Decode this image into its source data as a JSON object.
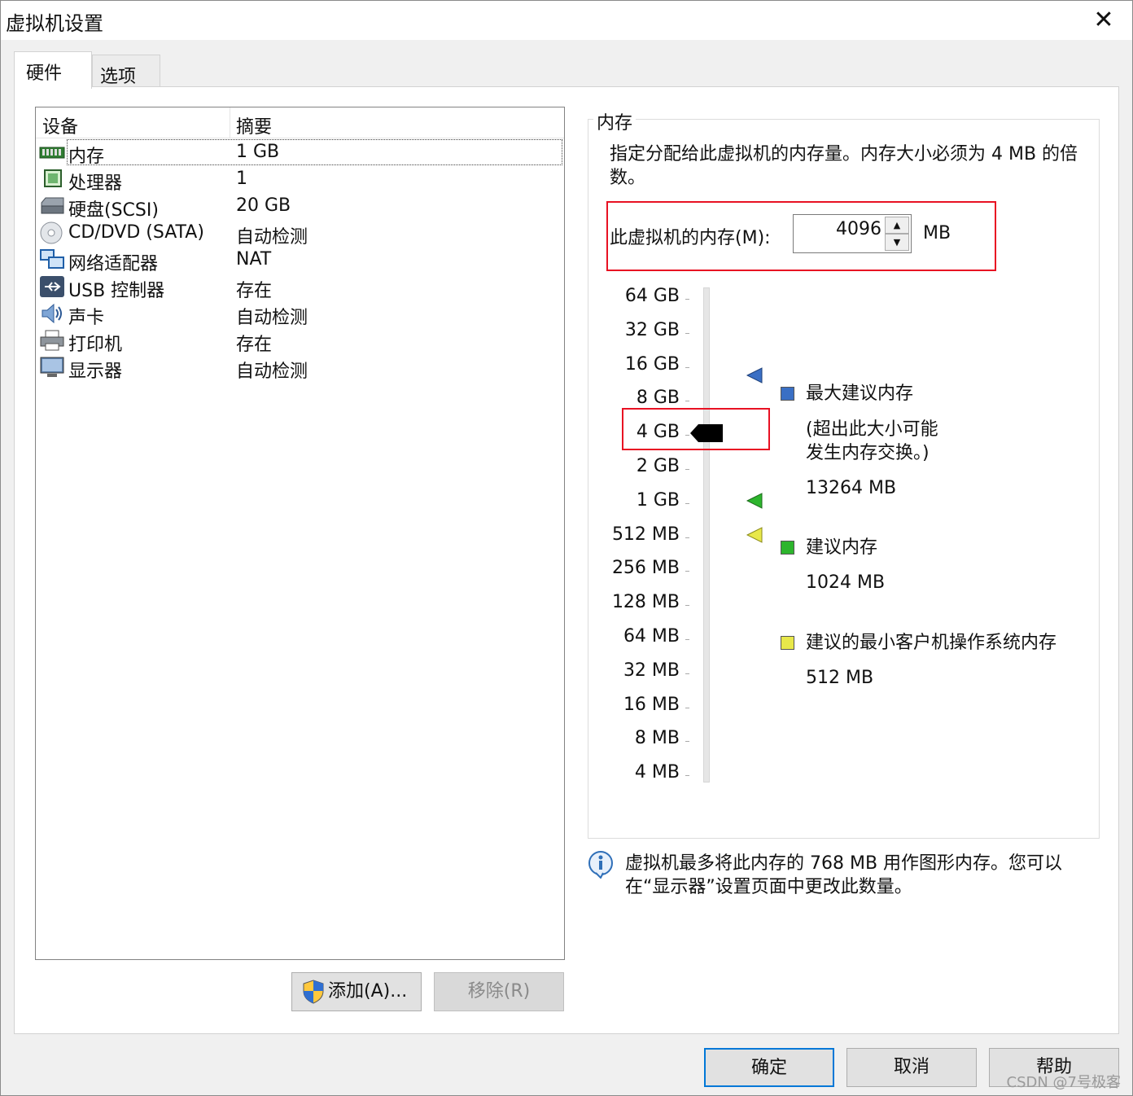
{
  "window": {
    "title": "虚拟机设置",
    "close": "✕"
  },
  "tabs": [
    {
      "label": "硬件"
    },
    {
      "label": "选项"
    }
  ],
  "device_list": {
    "col_device": "设备",
    "col_summary": "摘要",
    "rows": [
      {
        "name": "内存",
        "summary": "1 GB",
        "icon": "memory-icon"
      },
      {
        "name": "处理器",
        "summary": "1",
        "icon": "processor-icon"
      },
      {
        "name": "硬盘(SCSI)",
        "summary": "20 GB",
        "icon": "hard-disk-icon"
      },
      {
        "name": "CD/DVD (SATA)",
        "summary": "自动检测",
        "icon": "cd-dvd-icon"
      },
      {
        "name": "网络适配器",
        "summary": "NAT",
        "icon": "network-adapter-icon"
      },
      {
        "name": "USB 控制器",
        "summary": "存在",
        "icon": "usb-icon"
      },
      {
        "name": "声卡",
        "summary": "自动检测",
        "icon": "sound-card-icon"
      },
      {
        "name": "打印机",
        "summary": "存在",
        "icon": "printer-icon"
      },
      {
        "name": "显示器",
        "summary": "自动检测",
        "icon": "display-icon"
      }
    ]
  },
  "buttons": {
    "add": "添加(A)...",
    "remove": "移除(R)",
    "ok": "确定",
    "cancel": "取消",
    "help": "帮助"
  },
  "memory": {
    "group_title": "内存",
    "description": "指定分配给此虚拟机的内存量。内存大小必须为 4 MB 的倍数。",
    "field_label": "此虚拟机的内存(M):",
    "value": "4096",
    "unit": "MB",
    "scale": [
      "64 GB",
      "32 GB",
      "16 GB",
      "8 GB",
      "4 GB",
      "2 GB",
      "1 GB",
      "512 MB",
      "256 MB",
      "128 MB",
      "64 MB",
      "32 MB",
      "16 MB",
      "8 MB",
      "4 MB"
    ],
    "selected": "4 GB",
    "max_recommended": {
      "label": "最大建议内存",
      "note_line1": "(超出此大小可能",
      "note_line2": "发生内存交换。)",
      "value": "13264 MB",
      "color": "#3a6fc4"
    },
    "recommended": {
      "label": "建议内存",
      "value": "1024 MB",
      "color": "#2db52d"
    },
    "min_guest": {
      "label": "建议的最小客户机操作系统内存",
      "value": "512 MB",
      "color": "#e8e84a"
    }
  },
  "info": {
    "line1": "虚拟机最多将此内存的 768 MB 用作图形内存。您可以",
    "line2": "在“显示器”设置页面中更改此数量。"
  },
  "watermark": "CSDN @7号极客"
}
